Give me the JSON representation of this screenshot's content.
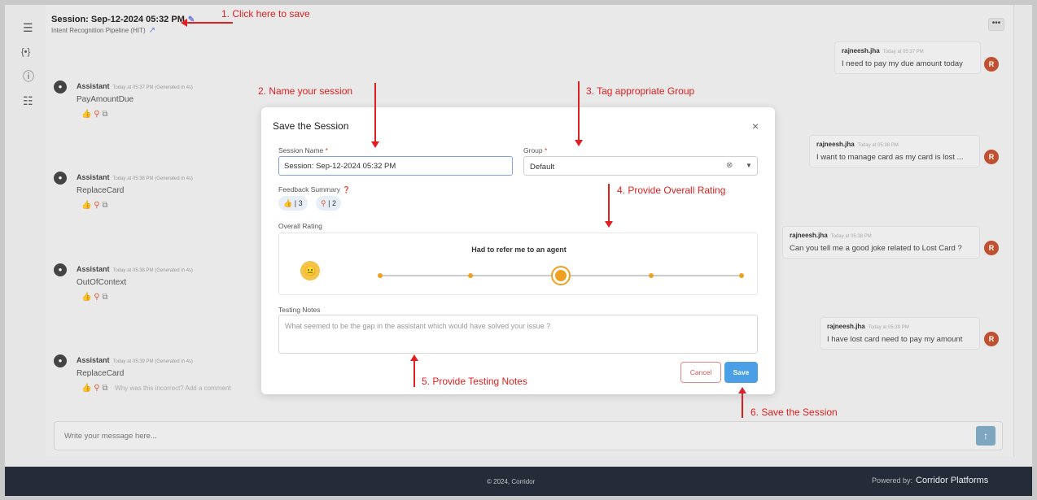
{
  "header": {
    "session_title": "Session: Sep-12-2024 05:32 PM",
    "pipeline": "Intent Recognition Pipeline (HIT)",
    "more": "•••"
  },
  "sidebar": {
    "icons": [
      {
        "name": "list-icon",
        "glyph": "☰"
      },
      {
        "name": "variable-braces-icon",
        "glyph": "{•}"
      },
      {
        "name": "info-icon",
        "glyph": "ⓘ"
      },
      {
        "name": "sliders-icon",
        "glyph": "☷"
      }
    ]
  },
  "assistant_messages": [
    {
      "name": "Assistant",
      "time": "Today at 05:37 PM (Generated in 4s)",
      "text": "PayAmountDue"
    },
    {
      "name": "Assistant",
      "time": "Today at 05:38 PM (Generated in 4s)",
      "text": "ReplaceCard"
    },
    {
      "name": "Assistant",
      "time": "Today at 05:38 PM (Generated in 4s)",
      "text": "OutOfContext"
    },
    {
      "name": "Assistant",
      "time": "Today at 05:39 PM (Generated in 4s)",
      "text": "ReplaceCard",
      "feedback_prompt": "Why was this incorrect? Add a comment"
    }
  ],
  "user_messages": [
    {
      "name": "rajneesh.jha",
      "time": "Today at 05:37 PM",
      "text": "I need to pay my due amount today",
      "avatar": "R"
    },
    {
      "name": "rajneesh.jha",
      "time": "Today at 05:38 PM",
      "text": "I want to manage card as my card is lost ...",
      "avatar": "R"
    },
    {
      "name": "rajneesh.jha",
      "time": "Today at 05:38 PM",
      "text": "Can you tell me a good joke related to Lost Card ?",
      "avatar": "R"
    },
    {
      "name": "rajneesh.jha",
      "time": "Today at 05:39 PM",
      "text": "I have lost card need to pay my amount",
      "avatar": "R"
    }
  ],
  "composer": {
    "placeholder": "Write your message here...",
    "send": "↑"
  },
  "footer": {
    "copyright": "© 2024, Corridor",
    "powered_by": "Powered by:",
    "brand": "Corridor Platforms"
  },
  "modal": {
    "title": "Save the Session",
    "close": "×",
    "session_name_label": "Session Name",
    "session_name_value": "Session: Sep-12-2024 05:32 PM",
    "group_label": "Group",
    "group_value": "Default",
    "required_mark": "*",
    "feedback_label": "Feedback Summary",
    "feedback_likes": "3",
    "feedback_dislikes": "2",
    "rating_label": "Overall Rating",
    "rating_caption": "Had to refer me to an agent",
    "rating_steps": 5,
    "rating_selected": 3,
    "notes_label": "Testing Notes",
    "notes_placeholder": "What seemed to be the gap in the assistant which would have solved your issue ?",
    "cancel": "Cancel",
    "save": "Save"
  },
  "annotations": {
    "a1": "1. Click here to save",
    "a2": "2. Name your session",
    "a3": "3. Tag appropriate Group",
    "a4": "4. Provide Overall Rating",
    "a5": "5. Provide Testing Notes",
    "a6": "6. Save the Session"
  },
  "colors": {
    "annotation": "#e02020",
    "primary": "#4a9fe6",
    "rating": "#f0a020",
    "footer": "#262b3a"
  }
}
